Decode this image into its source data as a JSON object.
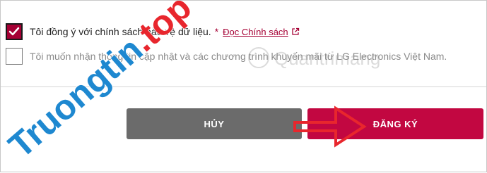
{
  "consent": {
    "privacy_label": "Tôi đồng ý với chính sách bảo vệ dữ liệu.",
    "required_mark": "*",
    "policy_link": "Đọc Chính sách",
    "privacy_checked": true,
    "newsletter_label": "Tôi muốn nhận thông tin cập nhật và các chương trình khuyến mãi từ LG Electronics Việt Nam.",
    "newsletter_checked": false
  },
  "buttons": {
    "cancel_label": "HỦY",
    "register_label": "ĐĂNG KÝ"
  },
  "watermarks": {
    "primary": "Truongtin.top",
    "secondary": "Quantrimang"
  },
  "colors": {
    "accent": "#a50034",
    "register_button": "#c20741",
    "cancel_button": "#6b6b6b",
    "watermark_red": "#e8262d",
    "watermark_blue": "#1e88d0"
  },
  "icons": [
    "checkmark-icon",
    "external-link-icon",
    "arrow-icon"
  ]
}
